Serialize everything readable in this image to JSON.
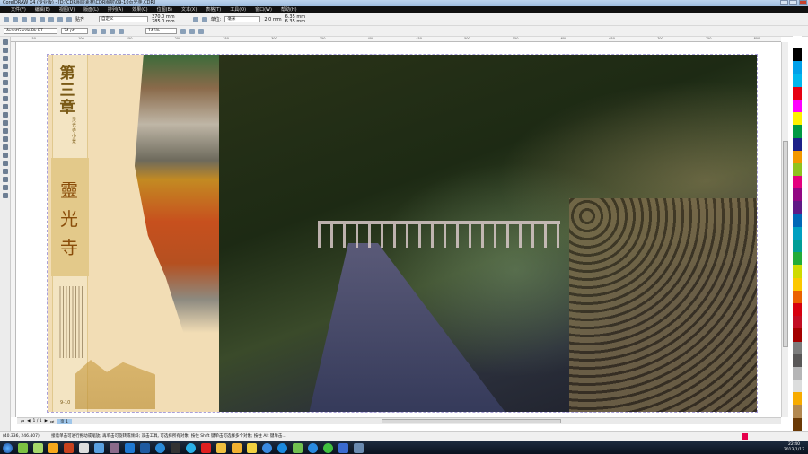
{
  "window": {
    "title": "CorelDRAW X4 (专业版) - [D:\\CDR图层素材\\CDR图层\\09-10页光寺.CDR]"
  },
  "menu": [
    "文件(F)",
    "编辑(E)",
    "视图(V)",
    "版面(L)",
    "排列(A)",
    "效果(C)",
    "位图(B)",
    "文本(X)",
    "表格(T)",
    "工具(O)",
    "窗口(W)",
    "帮助(H)"
  ],
  "toolbar": {
    "snap_label": "贴齐",
    "paper_preset": "自定义",
    "width": "370.0 mm",
    "height": "285.0 mm",
    "units_label": "单位:",
    "units": "毫米",
    "nudge": "2.0 mm",
    "dup_x": "6.35 mm",
    "dup_y": "6.35 mm"
  },
  "textbar": {
    "font": "AvantGarde Bk BT",
    "size": "24 pt",
    "zoom": "146%"
  },
  "ruler": [
    "50",
    "100",
    "150",
    "200",
    "250",
    "300",
    "350",
    "400",
    "450",
    "500",
    "550",
    "600",
    "650",
    "700",
    "750",
    "800"
  ],
  "page_content": {
    "chapter": "第三章",
    "subtitle": "灵光寺小景",
    "seal": "靈光寺",
    "page_number": "9-10"
  },
  "pagenav": {
    "count": "1 / 1",
    "tab": "页 1"
  },
  "status": {
    "coords": "(40.336, 246.407)",
    "hint": "接着单击可进行拖动或缩放; 再单击可旋转或倾斜; 双击工具, 可选择所有对象; 按住 Shift 键单击可选择多个对象; 按住 Alt 键单击..."
  },
  "clock": {
    "time": "22:40",
    "date": "2013/1/13"
  },
  "palette": [
    "#ffffff",
    "#000000",
    "#00a0e9",
    "#00b7ee",
    "#e60012",
    "#ff00ff",
    "#fff100",
    "#009944",
    "#1d2088",
    "#f39800",
    "#8fc31f",
    "#e4007f",
    "#920783",
    "#601986",
    "#0068b7",
    "#00a0c1",
    "#009e96",
    "#22ac38",
    "#cfdb00",
    "#fcc800",
    "#eb6100",
    "#d7000f",
    "#c30d23",
    "#a40000",
    "#7d7d7d",
    "#595757",
    "#b5b5b6",
    "#dcdddd",
    "#f7ab00",
    "#b28850",
    "#6a3906"
  ]
}
